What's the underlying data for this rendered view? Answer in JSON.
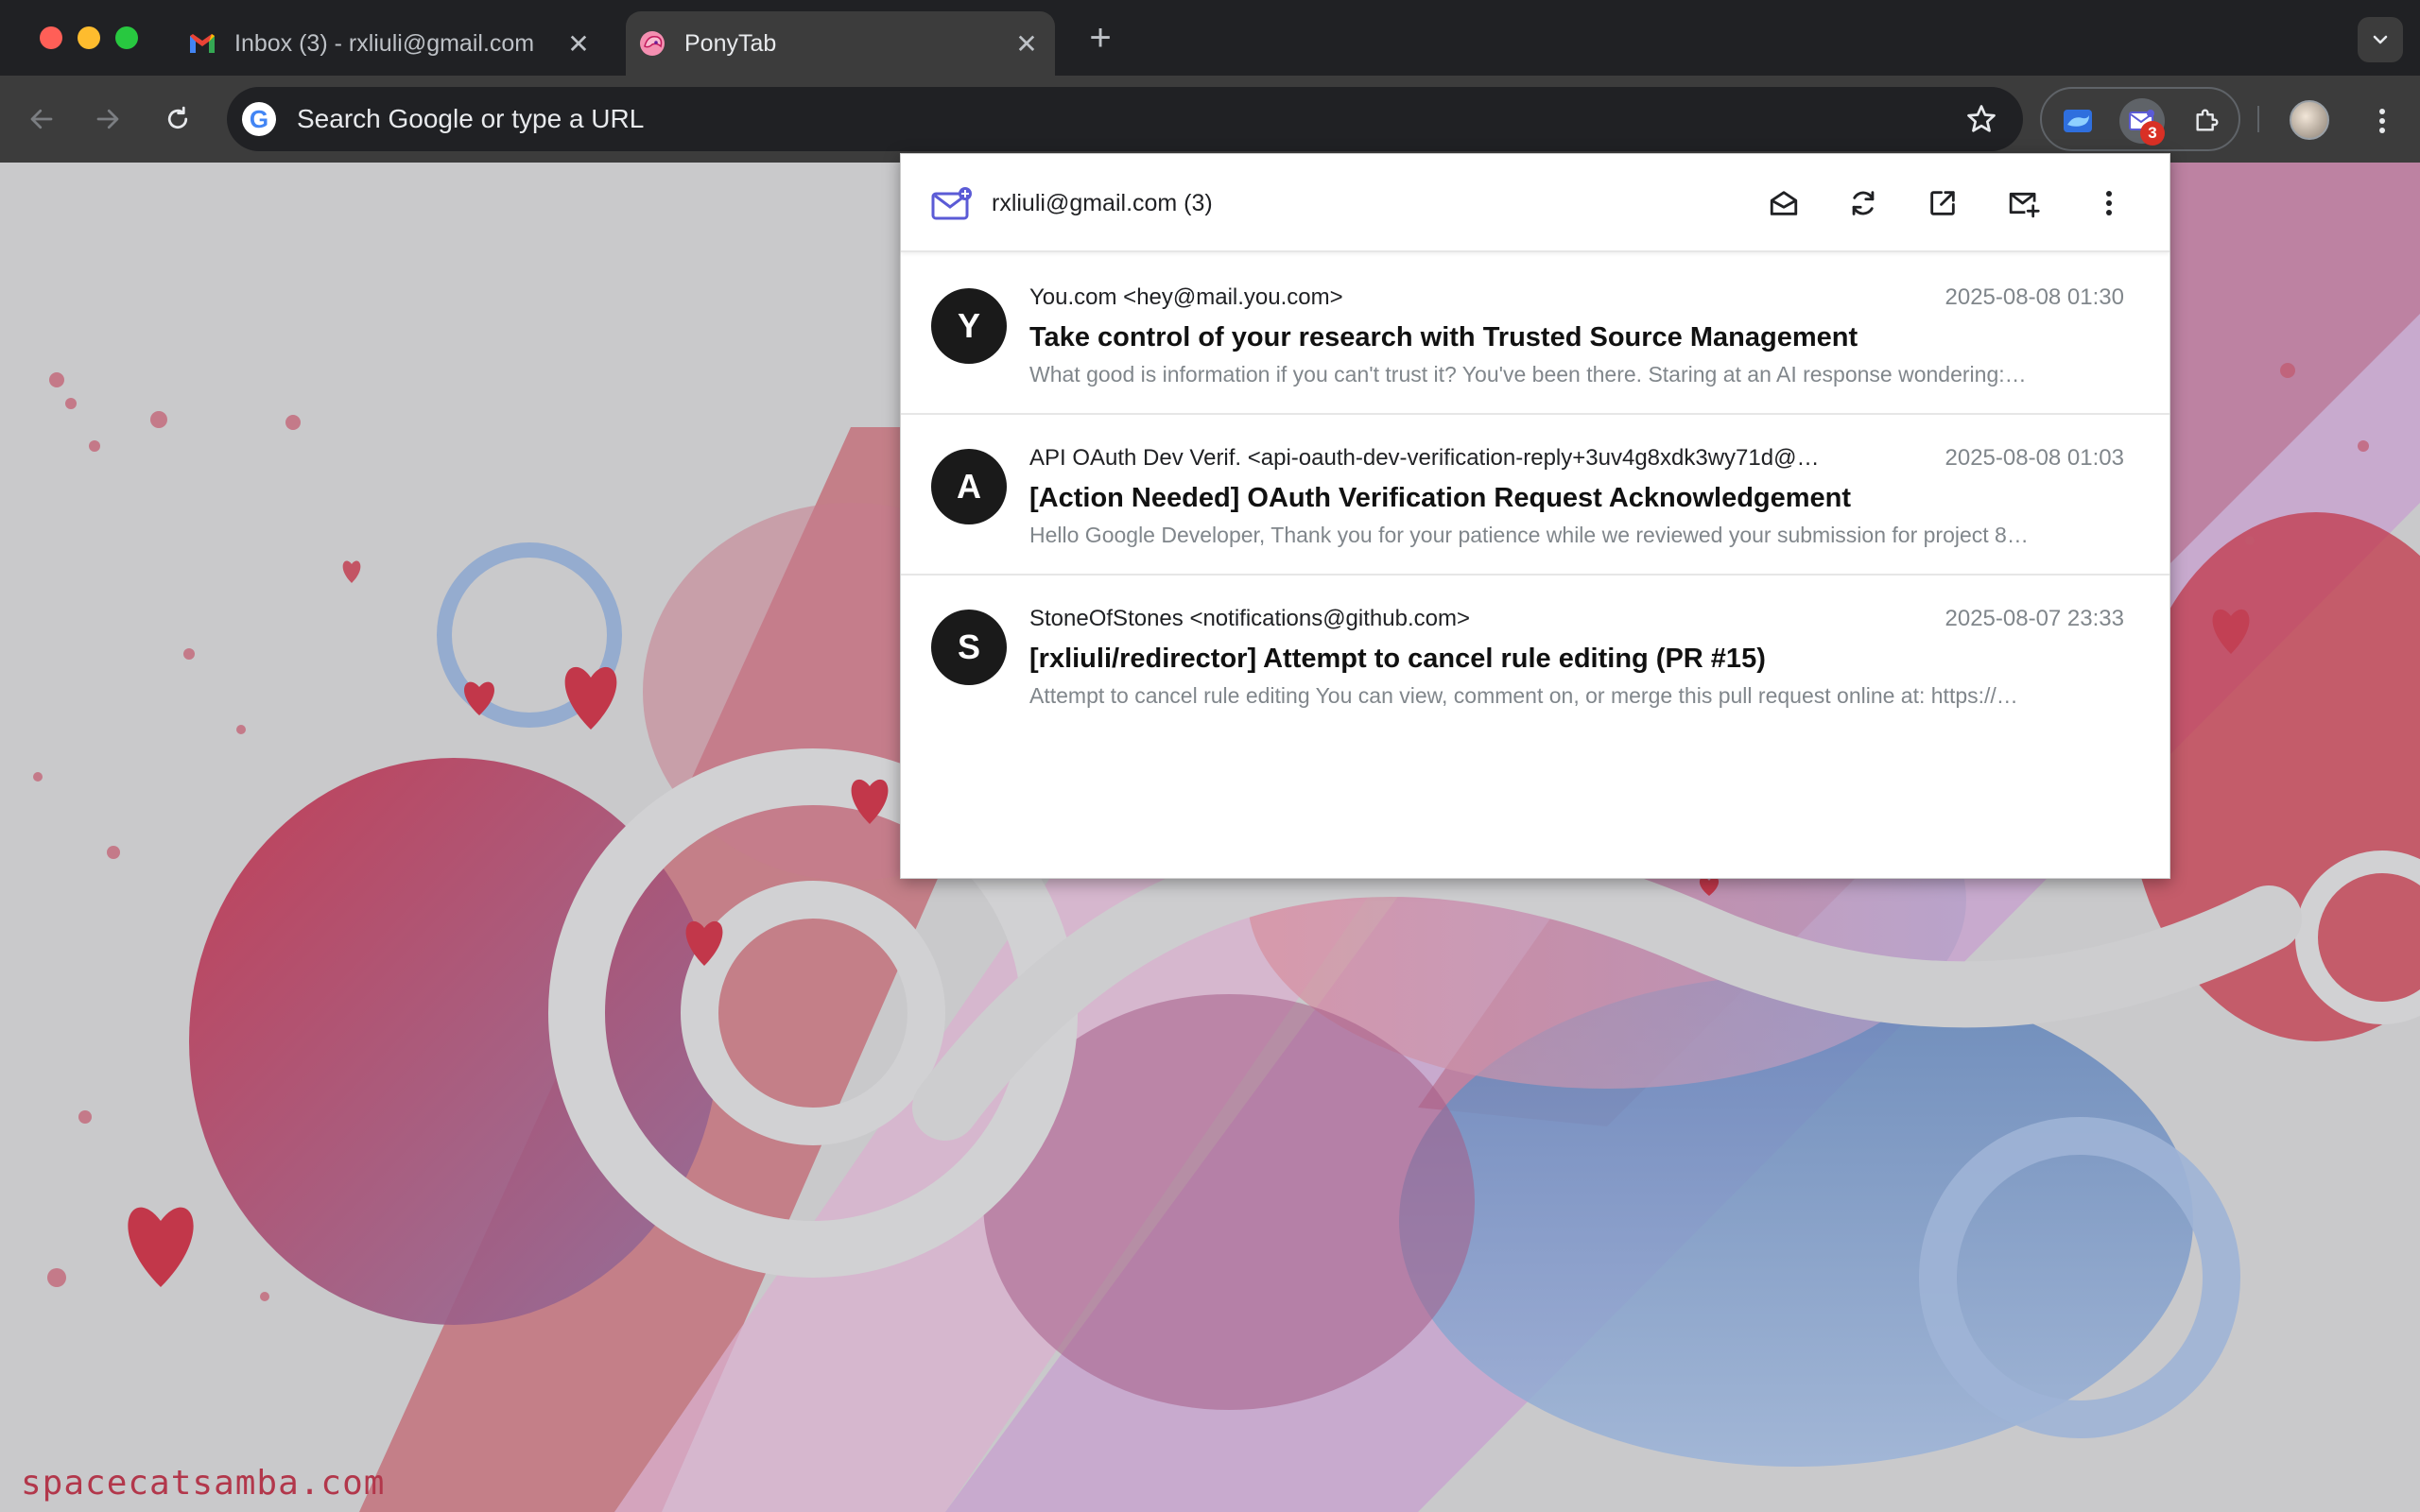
{
  "tabs": [
    {
      "title": "Inbox (3) - rxliuli@gmail.com",
      "favicon": "gmail-icon",
      "active": false
    },
    {
      "title": "PonyTab",
      "favicon": "ponytab-icon",
      "active": true
    }
  ],
  "toolbar": {
    "omnibox_text": "Search Google or type a URL"
  },
  "extension": {
    "badge_count": "3"
  },
  "popup": {
    "account_label": "rxliuli@gmail.com (3)",
    "actions": [
      "mark-all-read-icon",
      "refresh-icon",
      "open-external-icon",
      "compose-icon",
      "more-vert-icon"
    ],
    "emails": [
      {
        "avatar": "Y",
        "from": "You.com <hey@mail.you.com>",
        "date": "2025-08-08 01:30",
        "subject": "Take control of your research with Trusted Source Management",
        "snippet": "What good is information if you can't trust it? You've been there. Staring at an AI response wondering:…"
      },
      {
        "avatar": "A",
        "from": "API OAuth Dev Verif. <api-oauth-dev-verification-reply+3uv4g8xdk3wy71d@…",
        "date": "2025-08-08 01:03",
        "subject": "[Action Needed] OAuth Verification Request Acknowledgement",
        "snippet": "Hello Google Developer, Thank you for your patience while we reviewed your submission for project 8…"
      },
      {
        "avatar": "S",
        "from": "StoneOfStones <notifications@github.com>",
        "date": "2025-08-07 23:33",
        "subject": "[rxliuli/redirector] Attempt to cancel rule editing (PR #15)",
        "snippet": "Attempt to cancel rule editing You can view, comment on, or merge this pull request online at: https://…"
      }
    ]
  },
  "page": {
    "watermark": "spacecatsamba.com"
  },
  "colors": {
    "accent": "#5b5bd6",
    "badge": "#d93025",
    "chrome_dark": "#202124",
    "chrome_toolbar": "#3c3c3c"
  }
}
